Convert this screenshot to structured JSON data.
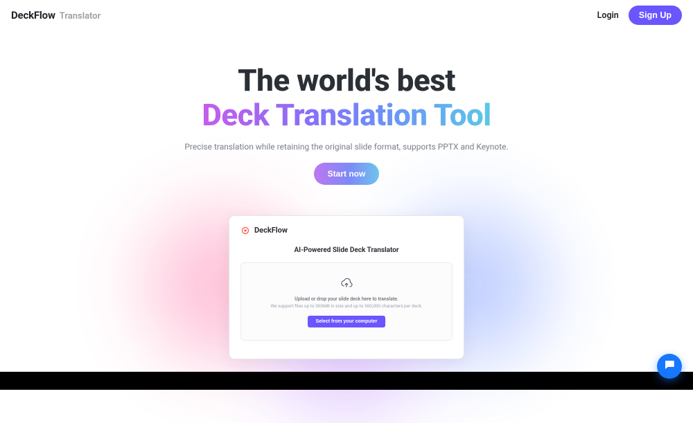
{
  "header": {
    "logo_main": "DeckFlow",
    "logo_sub": "Translator",
    "login_label": "Login",
    "signup_label": "Sign Up"
  },
  "hero": {
    "title_line1": "The world's best",
    "title_line2": "Deck Translation Tool",
    "subtitle": "Precise translation while retaining the original slide format, supports PPTX and Keynote.",
    "cta_label": "Start now"
  },
  "preview": {
    "brand": "DeckFlow",
    "title": "AI-Powered Slide Deck Translator",
    "dropzone_line1": "Upload or drop your slide deck here to translate.",
    "dropzone_line2": "We support files up to 300MB in size and up to 500,000 characters per deck.",
    "select_label": "Select from your computer"
  },
  "icons": {
    "upload": "upload-cloud-icon",
    "chat": "chat-bubble-icon",
    "brand_mark": "deckflow-mark-icon"
  },
  "colors": {
    "accent": "#6a55ff",
    "chat": "#1677ff"
  }
}
